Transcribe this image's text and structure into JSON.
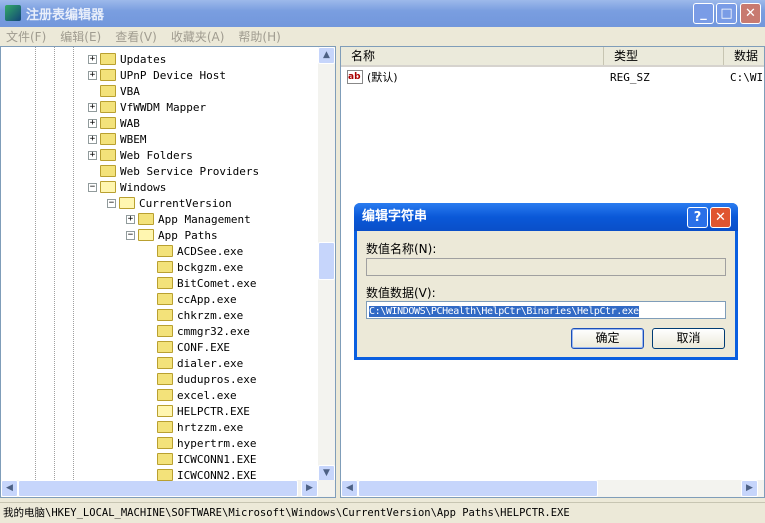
{
  "window": {
    "title": "注册表编辑器",
    "minimize": "_",
    "maximize": "□",
    "close": "✕"
  },
  "menu": [
    "文件(F)",
    "编辑(E)",
    "查看(V)",
    "收藏夹(A)",
    "帮助(H)"
  ],
  "tree": [
    {
      "label": "Updates",
      "level": 0,
      "expander": "+"
    },
    {
      "label": "UPnP Device Host",
      "level": 0,
      "expander": "+"
    },
    {
      "label": "VBA",
      "level": 0,
      "expander": ""
    },
    {
      "label": "VfWWDM Mapper",
      "level": 0,
      "expander": "+"
    },
    {
      "label": "WAB",
      "level": 0,
      "expander": "+"
    },
    {
      "label": "WBEM",
      "level": 0,
      "expander": "+"
    },
    {
      "label": "Web Folders",
      "level": 0,
      "expander": "+"
    },
    {
      "label": "Web Service Providers",
      "level": 0,
      "expander": ""
    },
    {
      "label": "Windows",
      "level": 0,
      "expander": "-"
    },
    {
      "label": "CurrentVersion",
      "level": 1,
      "expander": "-"
    },
    {
      "label": "App Management",
      "level": 2,
      "expander": "+"
    },
    {
      "label": "App Paths",
      "level": 2,
      "expander": "-"
    },
    {
      "label": "ACDSee.exe",
      "level": 3,
      "expander": ""
    },
    {
      "label": "bckgzm.exe",
      "level": 3,
      "expander": ""
    },
    {
      "label": "BitComet.exe",
      "level": 3,
      "expander": ""
    },
    {
      "label": "ccApp.exe",
      "level": 3,
      "expander": ""
    },
    {
      "label": "chkrzm.exe",
      "level": 3,
      "expander": ""
    },
    {
      "label": "cmmgr32.exe",
      "level": 3,
      "expander": ""
    },
    {
      "label": "CONF.EXE",
      "level": 3,
      "expander": ""
    },
    {
      "label": "dialer.exe",
      "level": 3,
      "expander": ""
    },
    {
      "label": "dudupros.exe",
      "level": 3,
      "expander": ""
    },
    {
      "label": "excel.exe",
      "level": 3,
      "expander": ""
    },
    {
      "label": "HELPCTR.EXE",
      "level": 3,
      "expander": "",
      "selected": true
    },
    {
      "label": "hrtzzm.exe",
      "level": 3,
      "expander": ""
    },
    {
      "label": "hypertrm.exe",
      "level": 3,
      "expander": ""
    },
    {
      "label": "ICWCONN1.EXE",
      "level": 3,
      "expander": ""
    },
    {
      "label": "ICWCONN2.EXE",
      "level": 3,
      "expander": ""
    }
  ],
  "list": {
    "columns": [
      "名称",
      "类型",
      "数据"
    ],
    "rows": [
      {
        "name": "(默认)",
        "type": "REG_SZ",
        "data": "C:\\WI"
      }
    ]
  },
  "status": "我的电脑\\HKEY_LOCAL_MACHINE\\SOFTWARE\\Microsoft\\Windows\\CurrentVersion\\App Paths\\HELPCTR.EXE",
  "dialog": {
    "title": "编辑字符串",
    "help": "?",
    "close": "✕",
    "name_label": "数值名称(N):",
    "name_value": "",
    "data_label": "数值数据(V):",
    "data_value": "C:\\WINDOWS\\PCHealth\\HelpCtr\\Binaries\\HelpCtr.exe",
    "ok": "确定",
    "cancel": "取消"
  },
  "colors": {
    "dialog_title": "#0a58d8",
    "selection": "#316ac5"
  }
}
